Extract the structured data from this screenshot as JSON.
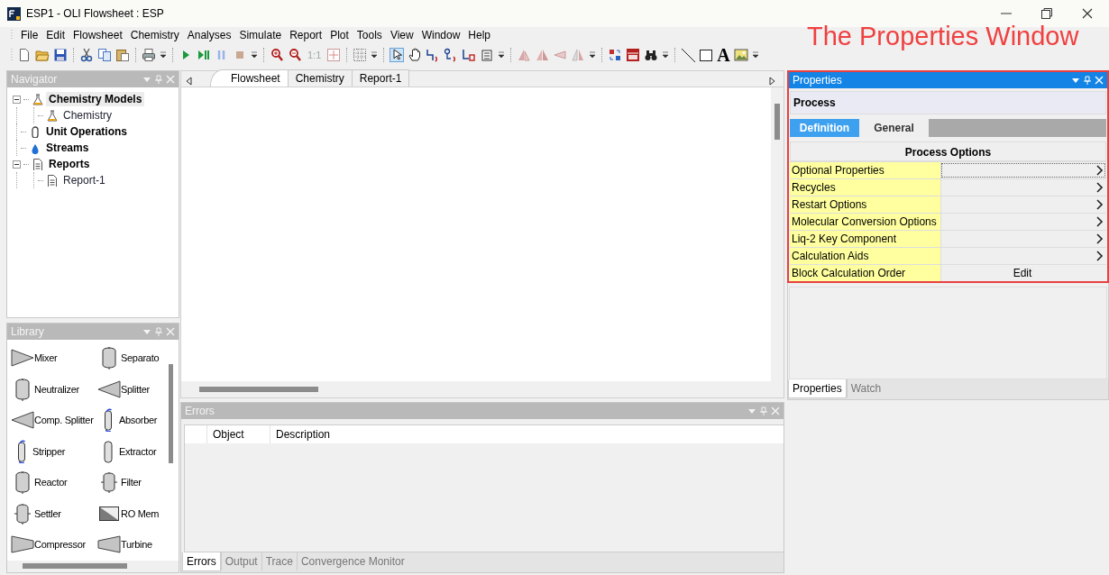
{
  "window": {
    "title": "ESP1 - OLI Flowsheet : ESP"
  },
  "menu": [
    "File",
    "Edit",
    "Flowsheet",
    "Chemistry",
    "Analyses",
    "Simulate",
    "Report",
    "Plot",
    "Tools",
    "View",
    "Window",
    "Help"
  ],
  "toolbar": {
    "zoom_label": "1:1",
    "text_tool": "A"
  },
  "annotation": "The Properties Window",
  "navigator": {
    "title": "Navigator",
    "active": false,
    "tree": [
      {
        "label": "Chemistry Models",
        "kind": "flask",
        "selected": true,
        "expanded": true,
        "children": [
          {
            "label": "Chemistry",
            "kind": "flask",
            "selected": false
          }
        ]
      },
      {
        "label": "Unit Operations",
        "kind": "unitop",
        "selected": false
      },
      {
        "label": "Streams",
        "kind": "drop",
        "selected": false
      },
      {
        "label": "Reports",
        "kind": "report",
        "selected": false,
        "expanded": true,
        "children": [
          {
            "label": "Report-1",
            "kind": "report",
            "selected": false
          }
        ]
      }
    ]
  },
  "library": {
    "title": "Library",
    "active": false,
    "items": [
      {
        "label": "Mixer",
        "kind": "mixer"
      },
      {
        "label": "Separato",
        "kind": "vessel"
      },
      {
        "label": "Neutralizer",
        "kind": "vessel"
      },
      {
        "label": "Splitter",
        "kind": "splitter"
      },
      {
        "label": "Comp. Splitter",
        "kind": "splitter"
      },
      {
        "label": "Absorber",
        "kind": "column"
      },
      {
        "label": "Stripper",
        "kind": "column"
      },
      {
        "label": "Extractor",
        "kind": "tall"
      },
      {
        "label": "Reactor",
        "kind": "vessel"
      },
      {
        "label": "Filter",
        "kind": "nozzled"
      },
      {
        "label": "Settler",
        "kind": "nozzled"
      },
      {
        "label": "RO Mem",
        "kind": "membrane"
      },
      {
        "label": "Compressor",
        "kind": "compressor"
      },
      {
        "label": "Turbine",
        "kind": "turbine"
      }
    ]
  },
  "document_tabs": [
    {
      "label": "Flowsheet",
      "selected": true
    },
    {
      "label": "Chemistry",
      "selected": false
    },
    {
      "label": "Report-1",
      "selected": false
    }
  ],
  "properties": {
    "title": "Properties",
    "active": true,
    "heading": "Process",
    "tabs": [
      {
        "label": "Definition",
        "selected": true
      },
      {
        "label": "General",
        "selected": false
      }
    ],
    "section": "Process Options",
    "rows": [
      {
        "label": "Optional Properties",
        "kind": "expand",
        "focused": true
      },
      {
        "label": "Recycles",
        "kind": "expand",
        "focused": false
      },
      {
        "label": "Restart Options",
        "kind": "expand",
        "focused": false
      },
      {
        "label": "Molecular Conversion Options",
        "kind": "expand",
        "focused": false
      },
      {
        "label": "Liq-2 Key Component",
        "kind": "expand",
        "focused": false
      },
      {
        "label": "Calculation Aids",
        "kind": "expand",
        "focused": false
      },
      {
        "label": "Block Calculation Order",
        "kind": "button",
        "value": "Edit",
        "focused": false
      }
    ],
    "bottom_tabs": [
      {
        "label": "Properties",
        "selected": true
      },
      {
        "label": "Watch",
        "selected": false
      }
    ]
  },
  "errors": {
    "title": "Errors",
    "active": false,
    "columns": [
      "Object",
      "Description"
    ],
    "tabs": [
      {
        "label": "Errors",
        "selected": true
      },
      {
        "label": "Output",
        "selected": false
      },
      {
        "label": "Trace",
        "selected": false
      },
      {
        "label": "Convergence Monitor",
        "selected": false
      }
    ]
  }
}
